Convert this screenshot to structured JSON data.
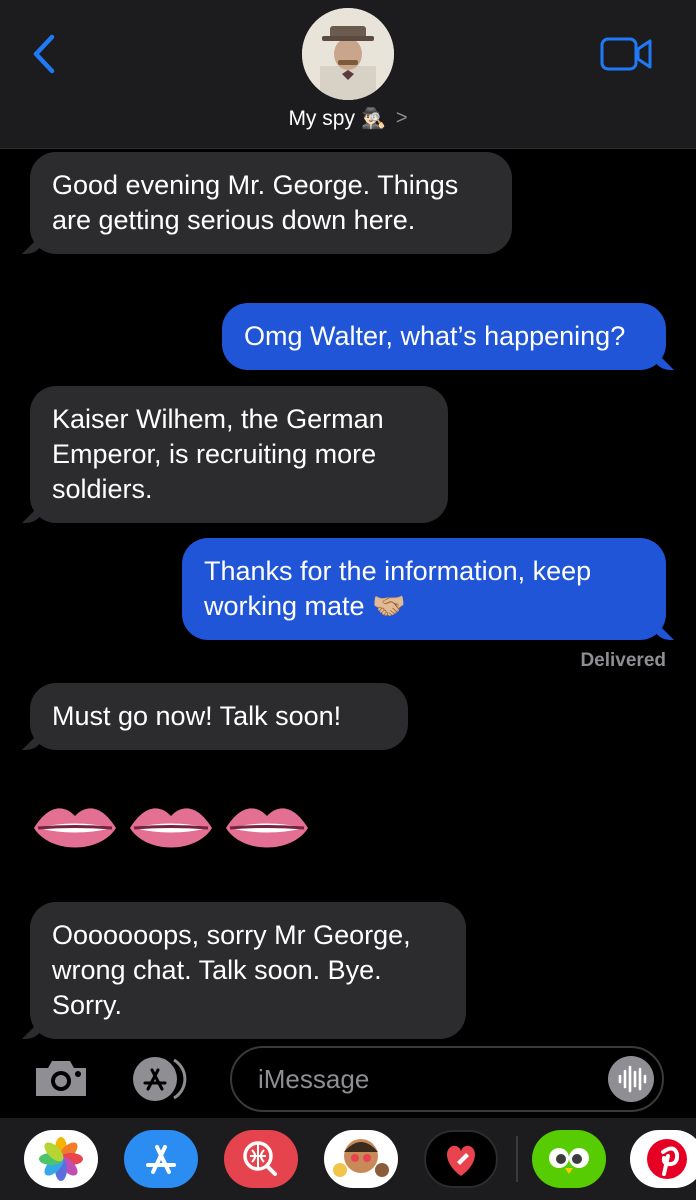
{
  "header": {
    "contact_name": "My spy",
    "contact_emoji": "🕵🏻‍♂️",
    "chevron": ">"
  },
  "messages": [
    {
      "direction": "incoming",
      "text": "Good evening Mr. George. Things are getting serious down here."
    },
    {
      "direction": "outgoing",
      "text": "Omg Walter, what’s happening?"
    },
    {
      "direction": "incoming",
      "text": "Kaiser Wilhem, the German Emperor, is recruiting more soldiers."
    },
    {
      "direction": "outgoing",
      "text": "Thanks for the information, keep working mate 🤝🏼"
    },
    {
      "direction": "incoming",
      "text": "Must go now! Talk soon!"
    },
    {
      "direction": "incoming",
      "text": "👄👄👄",
      "type": "emoji"
    },
    {
      "direction": "incoming",
      "text": "Ooooooops, sorry Mr George, wrong chat. Talk soon. Bye. Sorry."
    }
  ],
  "status": {
    "delivered": "Delivered"
  },
  "composer": {
    "placeholder": "iMessage"
  },
  "icons": {
    "back": "chevron-left-icon",
    "video": "video-camera-icon",
    "camera": "camera-icon",
    "apps": "app-store-icon",
    "audio": "audio-waveform-icon"
  },
  "tray": [
    "photos",
    "app-store",
    "web-search",
    "memoji",
    "digital-touch",
    "duolingo",
    "pinterest"
  ],
  "colors": {
    "accent": "#1f7af7",
    "outgoing_bubble": "#1f55d6",
    "incoming_bubble": "#2c2c2e",
    "background": "#000000"
  }
}
